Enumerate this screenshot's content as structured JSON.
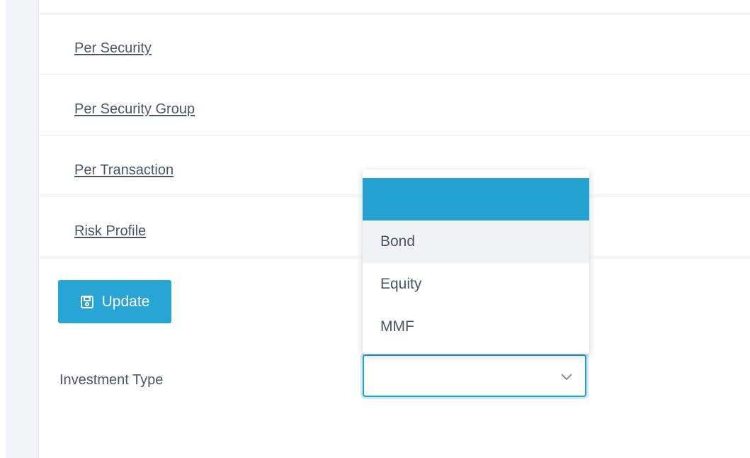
{
  "menu": {
    "items": [
      {
        "label": "Per Security"
      },
      {
        "label": "Per Security Group"
      },
      {
        "label": "Per Transaction"
      },
      {
        "label": "Risk Profile"
      }
    ]
  },
  "actions": {
    "update_label": "Update",
    "update_icon": "floppy-disk-save-icon"
  },
  "investment_type": {
    "label": "Investment Type",
    "selected_value": "",
    "dropdown_icon": "chevron-down-icon",
    "options": [
      "",
      "Bond",
      "Equity",
      "MMF"
    ],
    "highlighted_option": "",
    "hovered_option": "Bond"
  },
  "colors": {
    "accent": "#26a4d3",
    "text": "#4a5566",
    "hover_background": "#f1f3f6",
    "divider": "#e6e8eb"
  }
}
